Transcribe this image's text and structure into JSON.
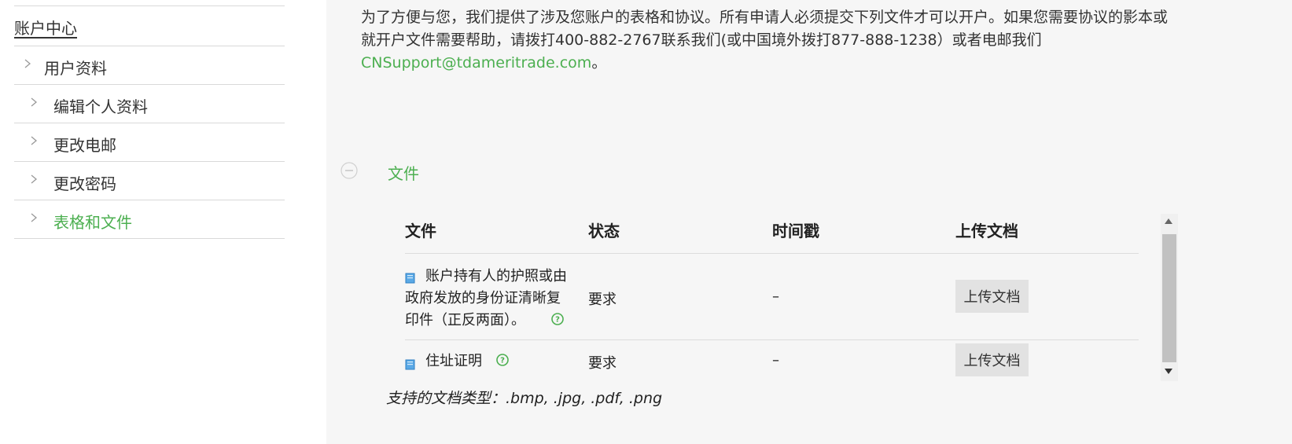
{
  "sidebar": {
    "title": "账户中心",
    "items": [
      {
        "label": "用户资料",
        "active": false
      },
      {
        "label": "编辑个人资料",
        "active": false
      },
      {
        "label": "更改电邮",
        "active": false
      },
      {
        "label": "更改密码",
        "active": false
      },
      {
        "label": "表格和文件",
        "active": true
      }
    ]
  },
  "intro": {
    "text": "为了方便与您，我们提供了涉及您账户的表格和协议。所有申请人必须提交下列文件才可以开户。如果您需要协议的影本或就开户文件需要帮助，请拨打400-882-2767联系我们(或中国境外拨打877-888-1238）或者电邮我们",
    "email": "CNSupport@tdameritrade.com",
    "suffix": "。"
  },
  "section": {
    "title": "文件",
    "icon": "collapse-minus-icon"
  },
  "table": {
    "headers": [
      "文件",
      "状态",
      "时间戳",
      "上传文档"
    ],
    "rows": [
      {
        "doc_lines": [
          "账户持有人的护照或由",
          "政府发放的身份证清晰复",
          "印件（正反两面）。"
        ],
        "status": "要求",
        "timestamp": "–",
        "action": "上传文档"
      },
      {
        "doc_lines": [
          "住址证明"
        ],
        "status": "要求",
        "timestamp": "–",
        "action": "上传文档"
      }
    ]
  },
  "footnote": "支持的文档类型：.bmp, .jpg, .pdf, .png",
  "colors": {
    "accent": "#4caf50",
    "panel_bg": "#f6f6f6",
    "button_bg": "#e2e2e2"
  }
}
